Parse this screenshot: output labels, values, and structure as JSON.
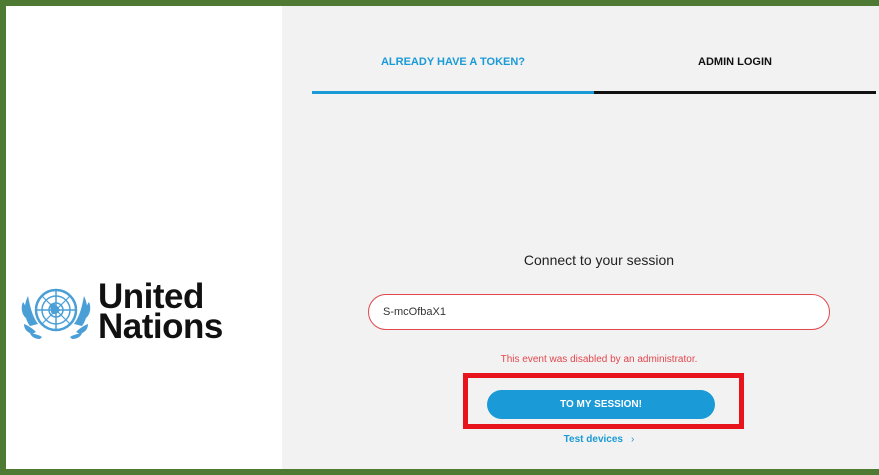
{
  "tabs": {
    "active_label": "ALREADY HAVE A TOKEN?",
    "inactive_label": "ADMIN LOGIN"
  },
  "logo": {
    "line1": "United",
    "line2": "Nations"
  },
  "connect": {
    "title": "Connect to your session",
    "input_value": "S-mcOfbaX1",
    "error": "This event was disabled by an administrator.",
    "button_label": "TO MY SESSION!",
    "test_devices_label": "Test devices",
    "chevron": "›"
  },
  "colors": {
    "accent": "#1a9ad6",
    "error": "#e2474d",
    "highlight": "#e8141b",
    "frame": "#4e7a34"
  }
}
